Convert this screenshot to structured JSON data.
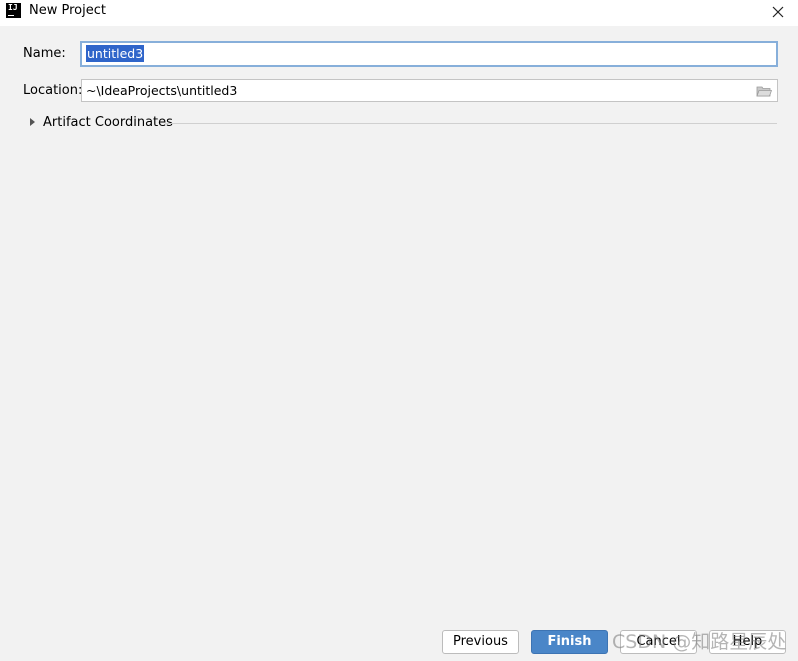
{
  "window": {
    "title": "New Project",
    "app_icon_text": "IJ"
  },
  "form": {
    "name_label": "Name:",
    "name_value": "untitled3",
    "location_label": "Location:",
    "location_value": "~\\IdeaProjects\\untitled3"
  },
  "artifact": {
    "label": "Artifact Coordinates",
    "expanded": false
  },
  "buttons": {
    "previous": "Previous",
    "finish": "Finish",
    "cancel": "Cancel",
    "help": "Help"
  },
  "watermark": "CSDN @知路星辰处",
  "colors": {
    "background": "#f2f2f2",
    "accent": "#4a86c8",
    "selection": "#2f65ca",
    "focus_border": "#87afda"
  },
  "icons": {
    "app": "intellij-icon",
    "close": "close-icon",
    "browse": "folder-icon",
    "expand": "chevron-right-icon"
  }
}
